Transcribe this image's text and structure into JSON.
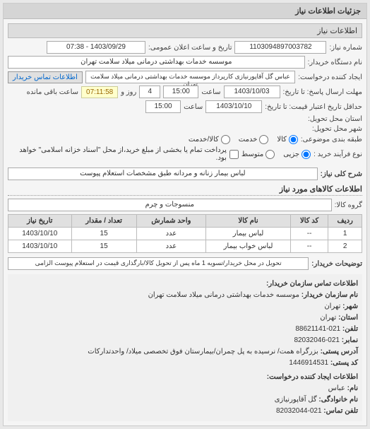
{
  "header": {
    "title": "جزئیات اطلاعات نیاز"
  },
  "tabs": {
    "main": "اطلاعات نیاز"
  },
  "form": {
    "request_no_label": "شماره نیاز:",
    "request_no": "1103094897003782",
    "public_datetime_label": "تاریخ و ساعت اعلان عمومی:",
    "public_datetime": "1403/09/29 - 07:38",
    "org_name_label": "نام دستگاه خریدار:",
    "org_name": "موسسه خدمات بهداشتی درمانی میلاد سلامت تهران",
    "creator_label": "ایجاد کننده درخواست:",
    "creator": "عباس گل آقاپورنیازی کارپرداز موسسه خدمات بهداشتی درمانی میلاد سلامت تهران",
    "contact_btn": "اطلاعات تماس خریدار",
    "response_deadline_label": "مهلت ارسال پاسخ: تا تاریخ:",
    "response_date": "1403/10/03",
    "time_label": "ساعت",
    "response_time": "15:00",
    "days_label": "روز و",
    "days": "4",
    "timer": "07:11:58",
    "remain_label": "ساعت باقی مانده",
    "validity_label": "حداقل تاریخ اعتبار قیمت: تا تاریخ:",
    "validity_date": "1403/10/10",
    "validity_time": "15:00",
    "delivery_province_label": "استان محل تحویل:",
    "delivery_city_label": "شهر محل تحویل:",
    "group_label": "طبقه بندی موضوعی:",
    "radio_kala": "کالا",
    "radio_khadamat": "خدمت",
    "radio_kala_khadamat": "کالا/خدمت",
    "purchase_type_label": "نوع فرآیند خرید :",
    "radio_jozi": "جزیی",
    "radio_motavaset": "متوسط",
    "note": "پرداخت تمام یا بخشی از مبلغ خرید،از محل \"اسناد خزانه اسلامی\" خواهد بود.",
    "desc_label": "شرح کلی نیاز:",
    "desc": "لباس بیمار زنانه و مردانه طبق مشخصات استعلام پیوست"
  },
  "goods": {
    "section_title": "اطلاعات کالاهای مورد نیاز",
    "group_label": "گروه کالا:",
    "group_value": "منسوجات و چرم",
    "columns": {
      "row": "ردیف",
      "code": "کد کالا",
      "name": "نام کالا",
      "unit": "واحد شمارش",
      "qty": "تعداد / مقدار",
      "date": "تاریخ نیاز"
    },
    "rows": [
      {
        "idx": "1",
        "code": "--",
        "name": "لباس بیمار",
        "unit": "عدد",
        "qty": "15",
        "date": "1403/10/10"
      },
      {
        "idx": "2",
        "code": "--",
        "name": "لباس خواب بیمار",
        "unit": "عدد",
        "qty": "15",
        "date": "1403/10/10"
      }
    ]
  },
  "buyer_notes": {
    "label": "توضیحات خریدار:",
    "text": "تحویل در محل خریدار/تسویه 1 ماه پس از تحویل کالا/بارگذاری قیمت در استعلام پیوست الزامی"
  },
  "contact": {
    "section1": "اطلاعات تماس سازمان خریدار:",
    "org_label": "نام سازمان خریدار:",
    "org": "موسسه خدمات بهداشتی درمانی میلاد سلامت تهران",
    "city_label": "شهر:",
    "city": "تهران",
    "province_label": "استان:",
    "province": "تهران",
    "phone_label": "تلفن:",
    "phone": "021-88621141",
    "fax_label": "نمابر:",
    "fax": "021-82032046",
    "addr_label": "آدرس پستی:",
    "addr": "بزرگراه همت/ نرسیده به پل چمران/بیمارستان فوق تخصصی میلاد/ واحدتدارکات",
    "postcode_label": "کد پستی:",
    "postcode": "1446914531",
    "section2": "اطلاعات ایجاد کننده درخواست:",
    "name_label": "نام:",
    "name": "عباس",
    "lastname_label": "نام خانوادگی:",
    "lastname": "گل آقاپورنیازی",
    "contact_phone_label": "تلفن تماس:",
    "contact_phone": "021-82032044"
  }
}
